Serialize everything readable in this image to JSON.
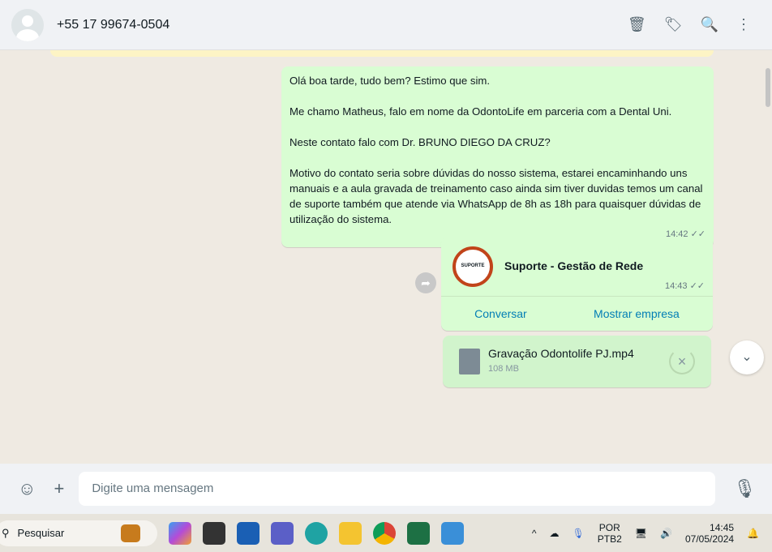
{
  "header": {
    "contact": "+55 17 99674-0504"
  },
  "messages": {
    "m1": {
      "paragraphs": [
        "Olá boa tarde, tudo bem? Estimo que sim.",
        "Me chamo Matheus, falo em nome da OdontoLife em parceria com a Dental Uni.",
        "Neste contato falo com Dr. BRUNO DIEGO DA CRUZ?",
        "Motivo do contato seria sobre dúvidas do nosso sistema, estarei encaminhando uns manuais e a aula gravada de treinamento caso ainda sim tiver duvidas temos um canal de suporte também que atende via WhatsApp de 8h as 18h para quaisquer dúvidas de utilização do sistema."
      ],
      "time": "14:42"
    },
    "m2": {
      "name": "Suporte - Gestão de Rede",
      "logo_text": "SUPORTE",
      "time": "14:43",
      "action1": "Conversar",
      "action2": "Mostrar empresa"
    },
    "m3": {
      "filename": "Gravação Odontolife PJ.mp4",
      "size": "108 MB"
    }
  },
  "composer": {
    "placeholder": "Digite uma mensagem"
  },
  "taskbar": {
    "search": "Pesquisar",
    "lang1": "POR",
    "lang2": "PTB2",
    "time": "14:45",
    "date": "07/05/2024"
  }
}
